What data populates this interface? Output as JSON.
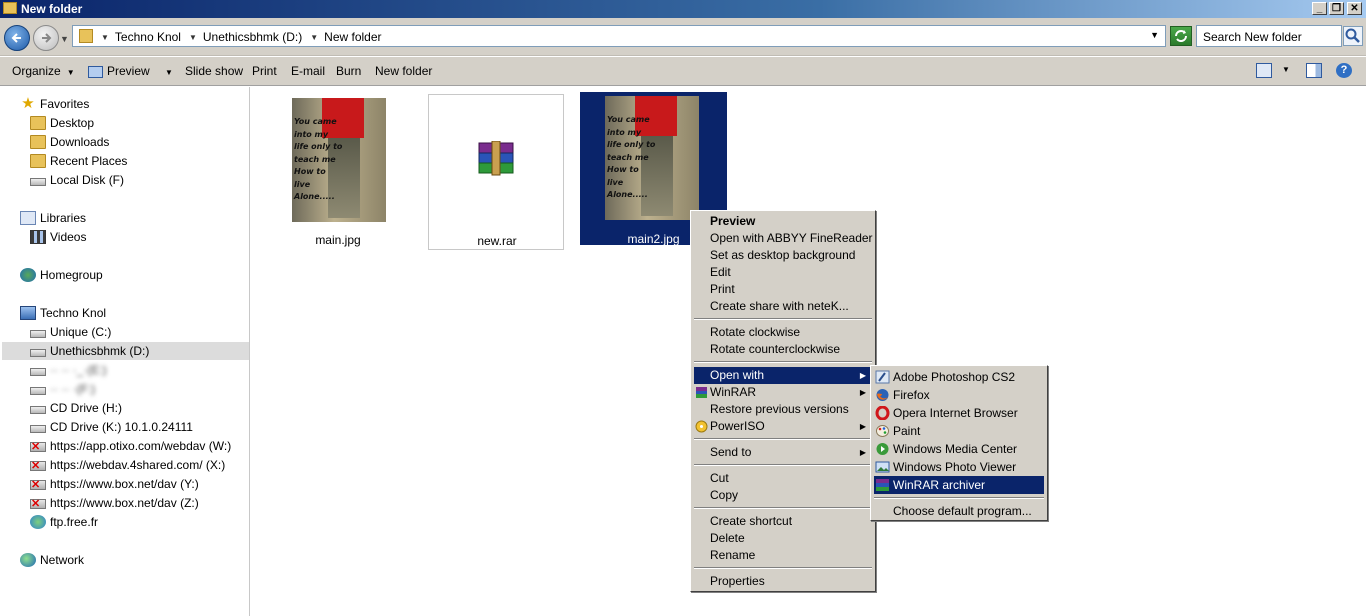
{
  "window": {
    "title": "New folder"
  },
  "address": {
    "crumbs": [
      "Techno Knol",
      "Unethicsbhmk (D:)",
      "New folder"
    ],
    "search_placeholder": "Search New folder"
  },
  "toolbar": {
    "organize": "Organize",
    "preview": "Preview",
    "slideshow": "Slide show",
    "print": "Print",
    "email": "E-mail",
    "burn": "Burn",
    "new_folder": "New folder"
  },
  "nav": {
    "favorites": "Favorites",
    "desktop": "Desktop",
    "downloads": "Downloads",
    "recent": "Recent Places",
    "local_f": "Local Disk (F)",
    "libraries": "Libraries",
    "videos": "Videos",
    "homegroup": "Homegroup",
    "computer": "Techno Knol",
    "unique_c": "Unique (C:)",
    "d_drive": "Unethicsbhmk (D:)",
    "blur1": "·· ·· ·_·(E:)",
    "blur2": "·· ·· ·(F:)",
    "cd_h": "CD Drive (H:)",
    "cd_k": "CD Drive (K:) 10.1.0.24111",
    "w_drive": "https://app.otixo.com/webdav (W:)",
    "x_drive": "https://webdav.4shared.com/ (X:)",
    "y_drive": "https://www.box.net/dav (Y:)",
    "z_drive": "https://www.box.net/dav (Z:)",
    "ftp": "ftp.free.fr",
    "network": "Network"
  },
  "files": [
    {
      "name": "main.jpg"
    },
    {
      "name": "new.rar"
    },
    {
      "name": "main2.jpg"
    }
  ],
  "photo_text": [
    "You came",
    "into my",
    "life only to",
    "teach me",
    "How to",
    "live",
    "Alone....."
  ],
  "context_menu": {
    "preview": "Preview",
    "abbyy": "Open with ABBYY FineReader",
    "desktop_bg": "Set as desktop background",
    "edit": "Edit",
    "print": "Print",
    "share": "Create share with neteK...",
    "rot_cw": "Rotate clockwise",
    "rot_ccw": "Rotate counterclockwise",
    "open_with": "Open with",
    "winrar": "WinRAR",
    "restore": "Restore previous versions",
    "poweriso": "PowerISO",
    "send_to": "Send to",
    "cut": "Cut",
    "copy": "Copy",
    "shortcut": "Create shortcut",
    "delete": "Delete",
    "rename": "Rename",
    "properties": "Properties"
  },
  "open_with_menu": {
    "photoshop": "Adobe Photoshop CS2",
    "firefox": "Firefox",
    "opera": "Opera Internet Browser",
    "paint": "Paint",
    "wmc": "Windows Media Center",
    "wpv": "Windows Photo Viewer",
    "winrar": "WinRAR archiver",
    "choose": "Choose default program..."
  }
}
